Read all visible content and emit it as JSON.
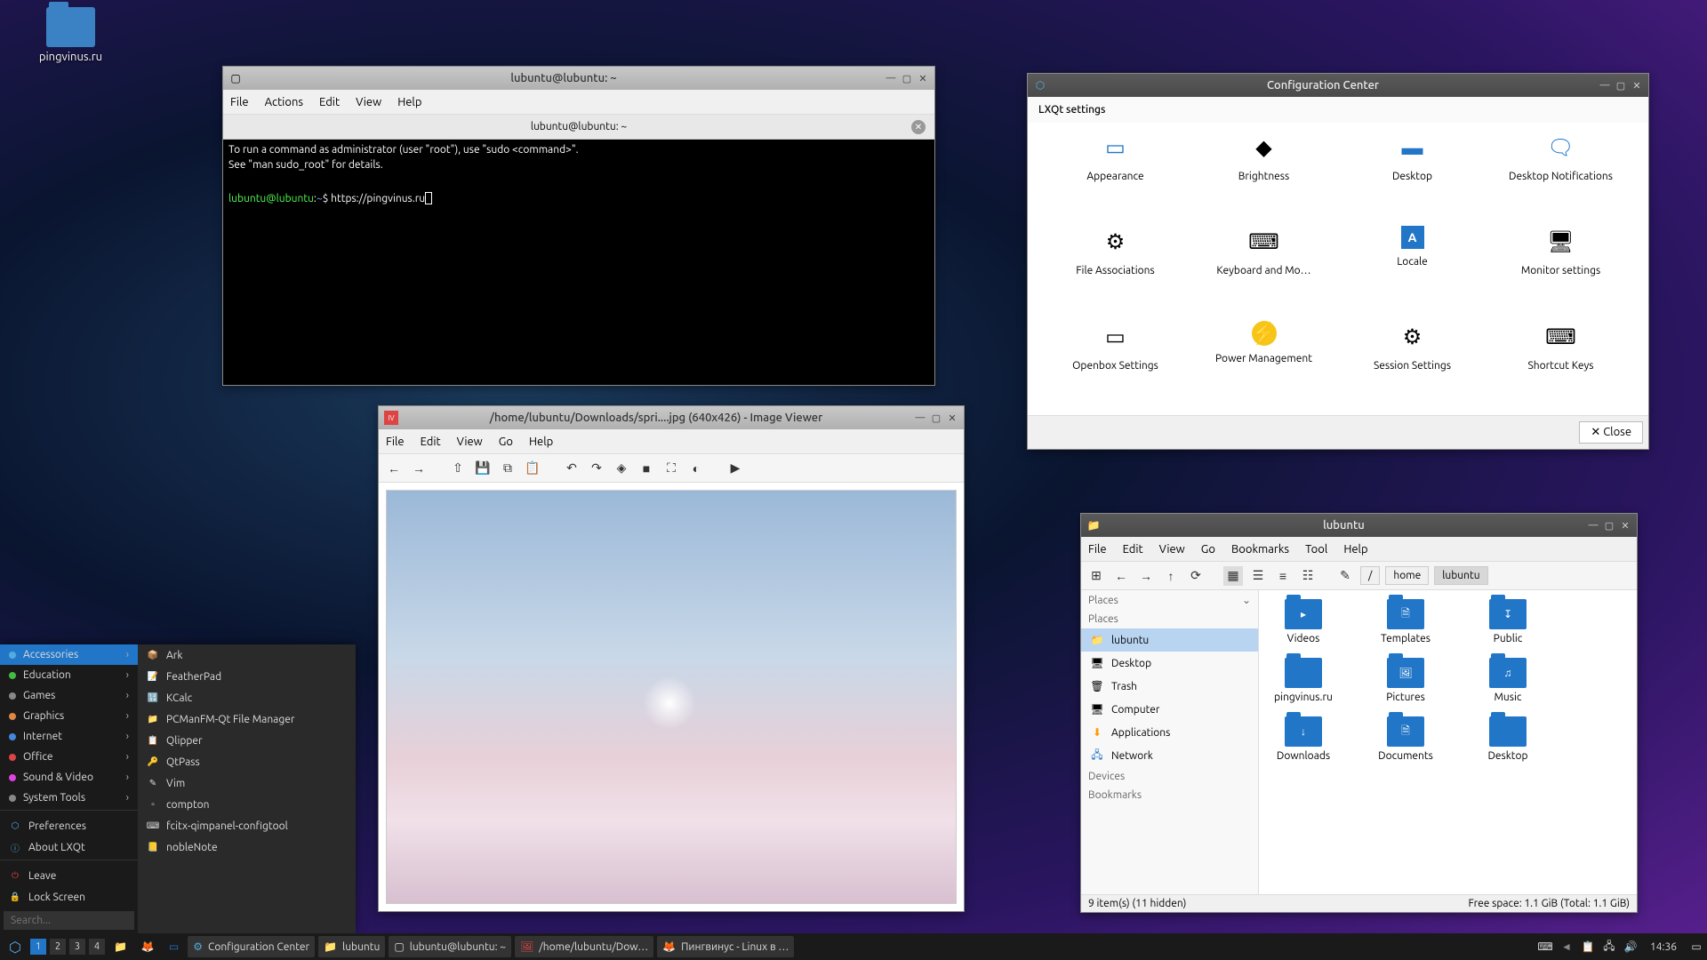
{
  "desktop": {
    "icon_label": "pingvinus.ru"
  },
  "terminal": {
    "title": "lubuntu@lubuntu: ~",
    "menu": [
      "File",
      "Actions",
      "Edit",
      "View",
      "Help"
    ],
    "tab": "lubuntu@lubuntu: ~",
    "line1": "To run a command as administrator (user \"root\"), use \"sudo <command>\".",
    "line2": "See \"man sudo_root\" for details.",
    "prompt_user": "lubuntu@lubuntu",
    "prompt_sep": ":",
    "prompt_dir": "~",
    "prompt_end": "$ ",
    "command": "https://pingvinus.ru"
  },
  "imageviewer": {
    "title": "/home/lubuntu/Downloads/spri....jpg (640x426) - Image Viewer",
    "menu": [
      "File",
      "Edit",
      "View",
      "Go",
      "Help"
    ]
  },
  "config": {
    "title": "Configuration Center",
    "section": "LXQt settings",
    "items": [
      "Appearance",
      "Brightness",
      "Desktop",
      "Desktop Notifications",
      "File Associations",
      "Keyboard and Mo…",
      "Locale",
      "Monitor settings",
      "Openbox Settings",
      "Power Management",
      "Session Settings",
      "Shortcut Keys"
    ],
    "close": "✕ Close"
  },
  "filemgr": {
    "title": "lubuntu",
    "menu": [
      "File",
      "Edit",
      "View",
      "Go",
      "Bookmarks",
      "Tool",
      "Help"
    ],
    "path": [
      "/",
      "home",
      "lubuntu"
    ],
    "sidebar_hdr": "Places",
    "sidebar_sec1": "Places",
    "sidebar_items": [
      "lubuntu",
      "Desktop",
      "Trash",
      "Computer",
      "Applications",
      "Network"
    ],
    "sidebar_sec2": "Devices",
    "sidebar_sec3": "Bookmarks",
    "files": [
      {
        "name": "Videos",
        "icon": "▸"
      },
      {
        "name": "Templates",
        "icon": "🗎"
      },
      {
        "name": "Public",
        "icon": "↧"
      },
      {
        "name": "pingvinus.ru",
        "icon": ""
      },
      {
        "name": "Pictures",
        "icon": "🖼"
      },
      {
        "name": "Music",
        "icon": "♫"
      },
      {
        "name": "Downloads",
        "icon": "↓"
      },
      {
        "name": "Documents",
        "icon": "🗎"
      },
      {
        "name": "Desktop",
        "icon": ""
      }
    ],
    "status_left": "9 item(s) (11 hidden)",
    "status_right": "Free space: 1.1 GiB (Total: 1.1 GiB)"
  },
  "appmenu": {
    "categories": [
      "Accessories",
      "Education",
      "Games",
      "Graphics",
      "Internet",
      "Office",
      "Sound & Video",
      "System Tools"
    ],
    "extras": [
      "Preferences",
      "About LXQt"
    ],
    "bottom": [
      "Leave",
      "Lock Screen"
    ],
    "submenu": [
      "Ark",
      "FeatherPad",
      "KCalc",
      "PCManFM-Qt File Manager",
      "Qlipper",
      "QtPass",
      "Vim",
      "compton",
      "fcitx-qimpanel-configtool",
      "nobleNote"
    ],
    "search_placeholder": "Search..."
  },
  "taskbar": {
    "workspaces": [
      "1",
      "2",
      "3",
      "4"
    ],
    "tasks": [
      {
        "icon": "⚙",
        "label": "Configuration Center",
        "color": "#5ad"
      },
      {
        "icon": "📁",
        "label": "lubuntu",
        "color": "#2176c7"
      },
      {
        "icon": "▢",
        "label": "lubuntu@lubuntu: ~",
        "color": "#ddd"
      },
      {
        "icon": "🖼",
        "label": "/home/lubuntu/Dow…",
        "color": "#d44"
      },
      {
        "icon": "🦊",
        "label": "Пингвинус - Linux в …",
        "color": "#f60"
      }
    ],
    "time": "14:36"
  }
}
